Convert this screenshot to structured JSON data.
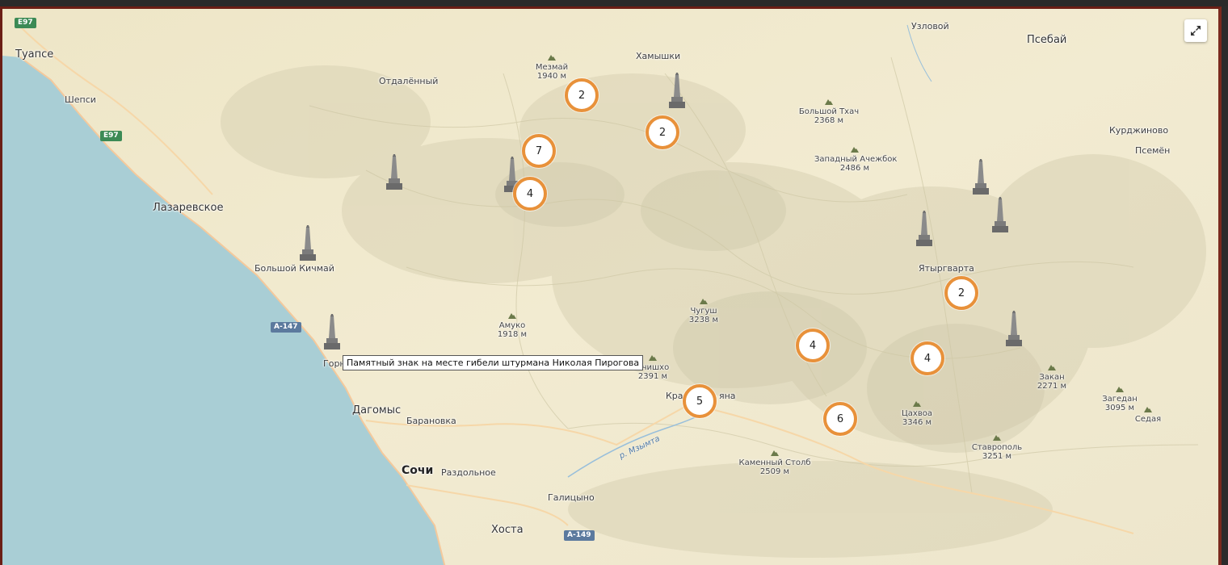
{
  "map": {
    "tooltip": "Памятный знак на месте гибели штурмана Николая Пирогова",
    "fullscreen_icon": "expand-icon",
    "colors": {
      "sea": "#aacfd6",
      "land": "#f1ead0",
      "cluster_ring": "#e8913a",
      "frame": "#6b1e15"
    }
  },
  "settlements": [
    {
      "id": "tuapse",
      "name": "Туапсе"
    },
    {
      "id": "shepsi",
      "name": "Шепси"
    },
    {
      "id": "otdalenny",
      "name": "Отдалённый"
    },
    {
      "id": "khamyshki",
      "name": "Хамышки"
    },
    {
      "id": "uzlovoy",
      "name": "Узловой"
    },
    {
      "id": "psebay",
      "name": "Псебай"
    },
    {
      "id": "kurdzhinovo",
      "name": "Курджиново"
    },
    {
      "id": "psemen",
      "name": "Псемён"
    },
    {
      "id": "lazarevskoe",
      "name": "Лазаревское"
    },
    {
      "id": "bolshoy_kichmay",
      "name": "Большой Кичмай"
    },
    {
      "id": "yatyrgvarta",
      "name": "Ятыргварта"
    },
    {
      "id": "gorny",
      "name": "Горн"
    },
    {
      "id": "dagomys",
      "name": "Дагомыс"
    },
    {
      "id": "baranovka",
      "name": "Барановка"
    },
    {
      "id": "sochi",
      "name": "Сочи"
    },
    {
      "id": "razdolnoe",
      "name": "Раздольное"
    },
    {
      "id": "galitsyno",
      "name": "Галицыно"
    },
    {
      "id": "khosta",
      "name": "Хоста"
    },
    {
      "id": "krasnaya_polyana_a",
      "name": "Кра"
    },
    {
      "id": "krasnaya_polyana_b",
      "name": "яна"
    }
  ],
  "peaks": [
    {
      "id": "mezmay",
      "name": "Мезмай",
      "elev": "1940 м"
    },
    {
      "id": "bolshoy_tkhach",
      "name": "Большой Тхач",
      "elev": "2368 м"
    },
    {
      "id": "zapadny_achezhbok",
      "name": "Западный Ачежбок",
      "elev": "2486 м"
    },
    {
      "id": "amuko",
      "name": "Амуко",
      "elev": "1918 м"
    },
    {
      "id": "chugush",
      "name": "Чугуш",
      "elev": "3238 м"
    },
    {
      "id": "achishkho",
      "name": "Ачишхо",
      "elev": "2391 м"
    },
    {
      "id": "zakan",
      "name": "Закан",
      "elev": "2271 м"
    },
    {
      "id": "zagedan",
      "name": "Загедан",
      "elev": "3095 м"
    },
    {
      "id": "sedaya",
      "name": "Седая",
      "elev": ""
    },
    {
      "id": "tsakhvoa",
      "name": "Цахвоа",
      "elev": "3346 м"
    },
    {
      "id": "stavropol",
      "name": "Ставрополь",
      "elev": "3251 м"
    },
    {
      "id": "kamenny_stolb",
      "name": "Каменный Столб",
      "elev": "2509 м"
    }
  ],
  "roads": [
    {
      "id": "e97_top",
      "label": "E97"
    },
    {
      "id": "e97_mid",
      "label": "E97"
    },
    {
      "id": "a147",
      "label": "А-147"
    },
    {
      "id": "a149",
      "label": "А-149"
    }
  ],
  "river": {
    "label": "р. Мзымта"
  },
  "clusters": [
    {
      "id": "c1",
      "count": "2"
    },
    {
      "id": "c2",
      "count": "2"
    },
    {
      "id": "c3",
      "count": "7"
    },
    {
      "id": "c4",
      "count": "4"
    },
    {
      "id": "c5",
      "count": "2"
    },
    {
      "id": "c6",
      "count": "4"
    },
    {
      "id": "c7",
      "count": "4"
    },
    {
      "id": "c8",
      "count": "5"
    },
    {
      "id": "c9",
      "count": "6"
    }
  ]
}
